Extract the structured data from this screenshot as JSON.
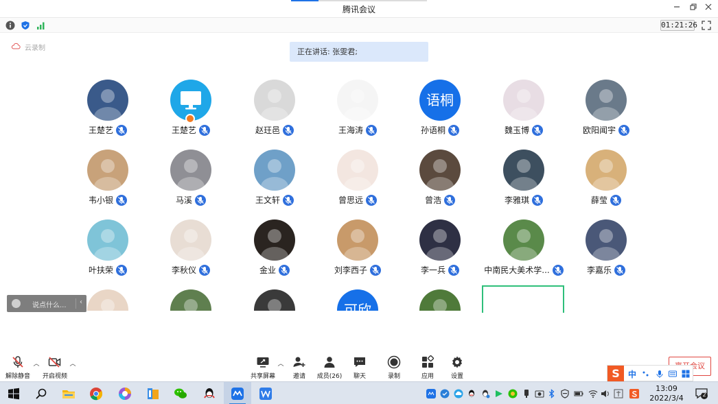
{
  "window": {
    "title": "腾讯会议"
  },
  "infobar": {
    "timer": "01:21:26"
  },
  "cloud_label": "云录制",
  "speaking": {
    "text": "正在讲话: 张雯君;"
  },
  "participants": [
    {
      "name": "王楚艺",
      "avatar": "photo",
      "color": "#3a5a8a"
    },
    {
      "name": "王楚艺",
      "avatar": "monitor-icon",
      "color": "#1fa7e8"
    },
    {
      "name": "赵玨邑",
      "avatar": "photo",
      "color": "#d9d9d9"
    },
    {
      "name": "王海涛",
      "avatar": "photo",
      "color": "#f5f5f5"
    },
    {
      "name": "孙语桐",
      "avatar": "text",
      "text": "语桐",
      "color": "#1670e8"
    },
    {
      "name": "魏玉博",
      "avatar": "photo",
      "color": "#e8dde4"
    },
    {
      "name": "欧阳闻宇",
      "avatar": "photo",
      "color": "#6a7a8a"
    },
    {
      "name": "韦小银",
      "avatar": "photo",
      "color": "#c8a27a"
    },
    {
      "name": "马溪",
      "avatar": "photo",
      "color": "#8f8f95"
    },
    {
      "name": "王文轩",
      "avatar": "photo",
      "color": "#6fa0c8"
    },
    {
      "name": "曾思远",
      "avatar": "photo",
      "color": "#f3e6e0"
    },
    {
      "name": "曾浩",
      "avatar": "photo",
      "color": "#5b4a3e"
    },
    {
      "name": "李雅琪",
      "avatar": "photo",
      "color": "#3d4f5f"
    },
    {
      "name": "薛莹",
      "avatar": "photo",
      "color": "#d8b17a"
    },
    {
      "name": "叶扶荣",
      "avatar": "photo",
      "color": "#7fc4d8"
    },
    {
      "name": "李秋仪",
      "avatar": "photo",
      "color": "#e8ddd4"
    },
    {
      "name": "金业",
      "avatar": "photo",
      "color": "#2a2420"
    },
    {
      "name": "刘李西子",
      "avatar": "photo",
      "color": "#c89a6a"
    },
    {
      "name": "李一兵",
      "avatar": "photo",
      "color": "#2e3044"
    },
    {
      "name": "中南民大美术学...",
      "avatar": "photo",
      "color": "#5a8a4a"
    },
    {
      "name": "李嘉乐",
      "avatar": "photo",
      "color": "#4a5878"
    },
    {
      "name": "",
      "avatar": "photo",
      "color": "#e9d6c6"
    },
    {
      "name": "",
      "avatar": "photo",
      "color": "#5f7f4f"
    },
    {
      "name": "",
      "avatar": "photo",
      "color": "#3a3a3a"
    },
    {
      "name": "",
      "avatar": "text",
      "text": "可欣",
      "color": "#1670e8"
    },
    {
      "name": "",
      "avatar": "photo",
      "color": "#4f7a3a"
    }
  ],
  "chat": {
    "placeholder": "说点什么..."
  },
  "toolbar": {
    "unmute": "解除静音",
    "start_video": "开启视频",
    "share_screen": "共享屏幕",
    "invite": "邀请",
    "members": "成员(26)",
    "chat": "聊天",
    "record": "录制",
    "apps": "应用",
    "settings": "设置",
    "leave": "离开会议"
  },
  "ime": {
    "mode": "中"
  },
  "taskbar": {
    "time": "13:09",
    "date": "2022/3/4",
    "notifications": "2"
  }
}
